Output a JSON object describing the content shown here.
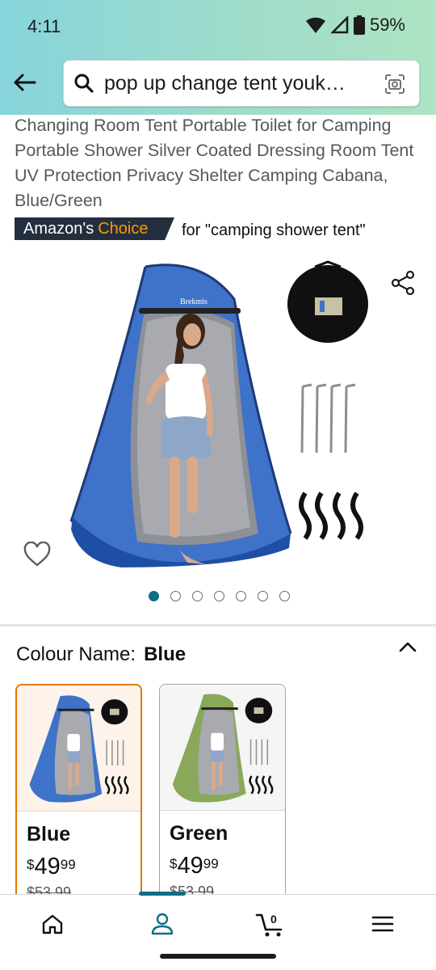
{
  "status_bar": {
    "time": "4:11",
    "battery": "59%"
  },
  "search": {
    "query": "pop up change tent youk…"
  },
  "product": {
    "title": "Changing Room Tent Portable Toilet for Camping Portable Shower Silver Coated Dressing Room Tent UV Protection Privacy Shelter Camping Cabana, Blue/Green",
    "badge_prefix": "Amazon's",
    "badge_highlight": "Choice",
    "badge_for": "for \"camping shower tent\"",
    "image_brand_text": "Brekmis",
    "image_count": 7,
    "active_image_index": 0
  },
  "colour": {
    "label": "Colour Name:",
    "selected": "Blue",
    "options": [
      {
        "name": "Blue",
        "currency": "$",
        "whole": "49",
        "fraction": "99",
        "strike": "$53.99",
        "selected": true
      },
      {
        "name": "Green",
        "currency": "$",
        "whole": "49",
        "fraction": "99",
        "strike": "$53.99",
        "selected": false
      }
    ]
  },
  "bottom_nav": {
    "cart_count": "0",
    "active": "account"
  },
  "colors": {
    "accent": "#0f6e87",
    "choice_orange": "#ff9900",
    "badge_dark": "#232f3e",
    "selected_border": "#e77600",
    "tent_blue": "#3b6fc6",
    "tent_green": "#8aa85a"
  }
}
